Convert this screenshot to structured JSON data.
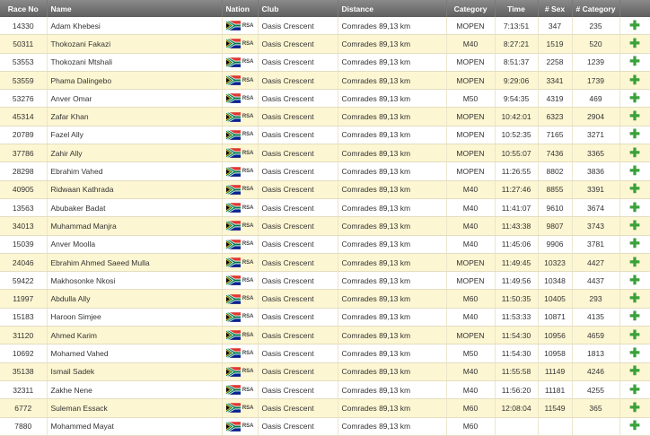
{
  "columns": {
    "race_no": "Race No",
    "name": "Name",
    "nation": "Nation",
    "club": "Club",
    "distance": "Distance",
    "category": "Category",
    "time": "Time",
    "sex_pos": "# Sex",
    "cat_pos": "# Category"
  },
  "nation_code": "RSA",
  "add_icon": "plus-icon",
  "colors": {
    "row_alt": "#fdf6d2",
    "header": "#6e6e6e",
    "plus": "#3aa13a"
  },
  "rows": [
    {
      "race_no": "14330",
      "name": "Adam Khebesi",
      "club": "Oasis Crescent",
      "distance": "Comrades 89,13 km",
      "category": "MOPEN",
      "time": "7:13:51",
      "sex_pos": "347",
      "cat_pos": "235"
    },
    {
      "race_no": "50311",
      "name": "Thokozani Fakazi",
      "club": "Oasis Crescent",
      "distance": "Comrades 89,13 km",
      "category": "M40",
      "time": "8:27:21",
      "sex_pos": "1519",
      "cat_pos": "520"
    },
    {
      "race_no": "53553",
      "name": "Thokozani Mtshali",
      "club": "Oasis Crescent",
      "distance": "Comrades 89,13 km",
      "category": "MOPEN",
      "time": "8:51:37",
      "sex_pos": "2258",
      "cat_pos": "1239"
    },
    {
      "race_no": "53559",
      "name": "Phama Dalingebo",
      "club": "Oasis Crescent",
      "distance": "Comrades 89,13 km",
      "category": "MOPEN",
      "time": "9:29:06",
      "sex_pos": "3341",
      "cat_pos": "1739"
    },
    {
      "race_no": "53276",
      "name": "Anver Omar",
      "club": "Oasis Crescent",
      "distance": "Comrades 89,13 km",
      "category": "M50",
      "time": "9:54:35",
      "sex_pos": "4319",
      "cat_pos": "469"
    },
    {
      "race_no": "45314",
      "name": "Zafar Khan",
      "club": "Oasis Crescent",
      "distance": "Comrades 89,13 km",
      "category": "MOPEN",
      "time": "10:42:01",
      "sex_pos": "6323",
      "cat_pos": "2904"
    },
    {
      "race_no": "20789",
      "name": "Fazel Ally",
      "club": "Oasis Crescent",
      "distance": "Comrades 89,13 km",
      "category": "MOPEN",
      "time": "10:52:35",
      "sex_pos": "7165",
      "cat_pos": "3271"
    },
    {
      "race_no": "37786",
      "name": "Zahir Ally",
      "club": "Oasis Crescent",
      "distance": "Comrades 89,13 km",
      "category": "MOPEN",
      "time": "10:55:07",
      "sex_pos": "7436",
      "cat_pos": "3365"
    },
    {
      "race_no": "28298",
      "name": "Ebrahim Vahed",
      "club": "Oasis Crescent",
      "distance": "Comrades 89,13 km",
      "category": "MOPEN",
      "time": "11:26:55",
      "sex_pos": "8802",
      "cat_pos": "3836"
    },
    {
      "race_no": "40905",
      "name": "Ridwaan Kathrada",
      "club": "Oasis Crescent",
      "distance": "Comrades 89,13 km",
      "category": "M40",
      "time": "11:27:46",
      "sex_pos": "8855",
      "cat_pos": "3391"
    },
    {
      "race_no": "13563",
      "name": "Abubaker Badat",
      "club": "Oasis Crescent",
      "distance": "Comrades 89,13 km",
      "category": "M40",
      "time": "11:41:07",
      "sex_pos": "9610",
      "cat_pos": "3674"
    },
    {
      "race_no": "34013",
      "name": "Muhammad Manjra",
      "club": "Oasis Crescent",
      "distance": "Comrades 89,13 km",
      "category": "M40",
      "time": "11:43:38",
      "sex_pos": "9807",
      "cat_pos": "3743"
    },
    {
      "race_no": "15039",
      "name": "Anver Moolla",
      "club": "Oasis Crescent",
      "distance": "Comrades 89,13 km",
      "category": "M40",
      "time": "11:45:06",
      "sex_pos": "9906",
      "cat_pos": "3781"
    },
    {
      "race_no": "24046",
      "name": "Ebrahim Ahmed Saeed Mulla",
      "club": "Oasis Crescent",
      "distance": "Comrades 89,13 km",
      "category": "MOPEN",
      "time": "11:49:45",
      "sex_pos": "10323",
      "cat_pos": "4427"
    },
    {
      "race_no": "59422",
      "name": "Makhosonke Nkosi",
      "club": "Oasis Crescent",
      "distance": "Comrades 89,13 km",
      "category": "MOPEN",
      "time": "11:49:56",
      "sex_pos": "10348",
      "cat_pos": "4437"
    },
    {
      "race_no": "11997",
      "name": "Abdulla Ally",
      "club": "Oasis Crescent",
      "distance": "Comrades 89,13 km",
      "category": "M60",
      "time": "11:50:35",
      "sex_pos": "10405",
      "cat_pos": "293"
    },
    {
      "race_no": "15183",
      "name": "Haroon Simjee",
      "club": "Oasis Crescent",
      "distance": "Comrades 89,13 km",
      "category": "M40",
      "time": "11:53:33",
      "sex_pos": "10871",
      "cat_pos": "4135"
    },
    {
      "race_no": "31120",
      "name": "Ahmed Karim",
      "club": "Oasis Crescent",
      "distance": "Comrades 89,13 km",
      "category": "MOPEN",
      "time": "11:54:30",
      "sex_pos": "10956",
      "cat_pos": "4659"
    },
    {
      "race_no": "10692",
      "name": "Mohamed Vahed",
      "club": "Oasis Crescent",
      "distance": "Comrades 89,13 km",
      "category": "M50",
      "time": "11:54:30",
      "sex_pos": "10958",
      "cat_pos": "1813"
    },
    {
      "race_no": "35138",
      "name": "Ismail Sadek",
      "club": "Oasis Crescent",
      "distance": "Comrades 89,13 km",
      "category": "M40",
      "time": "11:55:58",
      "sex_pos": "11149",
      "cat_pos": "4246"
    },
    {
      "race_no": "32311",
      "name": "Zakhe Nene",
      "club": "Oasis Crescent",
      "distance": "Comrades 89,13 km",
      "category": "M40",
      "time": "11:56:20",
      "sex_pos": "11181",
      "cat_pos": "4255"
    },
    {
      "race_no": "6772",
      "name": "Suleman Essack",
      "club": "Oasis Crescent",
      "distance": "Comrades 89,13 km",
      "category": "M60",
      "time": "12:08:04",
      "sex_pos": "11549",
      "cat_pos": "365"
    },
    {
      "race_no": "7880",
      "name": "Mohammed Mayat",
      "club": "Oasis Crescent",
      "distance": "Comrades 89,13 km",
      "category": "M60",
      "time": "",
      "sex_pos": "",
      "cat_pos": ""
    }
  ]
}
